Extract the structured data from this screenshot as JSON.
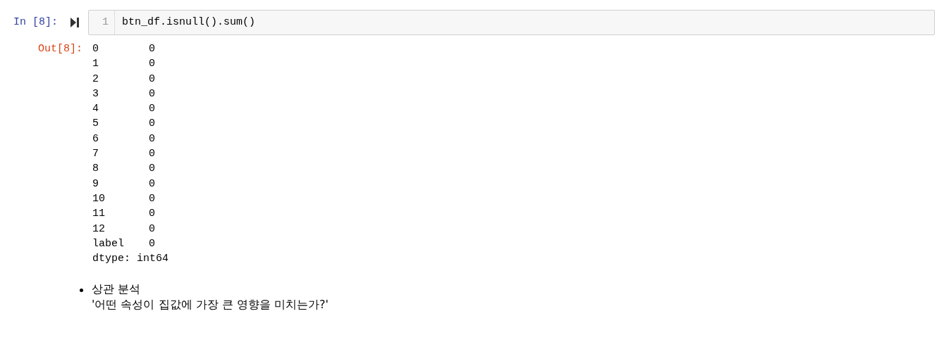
{
  "input_cell": {
    "prompt": "In [8]:",
    "line_number": "1",
    "code": "btn_df.isnull().sum()"
  },
  "output_cell": {
    "prompt": "Out[8]:",
    "rows": [
      {
        "index": "0",
        "value": "0"
      },
      {
        "index": "1",
        "value": "0"
      },
      {
        "index": "2",
        "value": "0"
      },
      {
        "index": "3",
        "value": "0"
      },
      {
        "index": "4",
        "value": "0"
      },
      {
        "index": "5",
        "value": "0"
      },
      {
        "index": "6",
        "value": "0"
      },
      {
        "index": "7",
        "value": "0"
      },
      {
        "index": "8",
        "value": "0"
      },
      {
        "index": "9",
        "value": "0"
      },
      {
        "index": "10",
        "value": "0"
      },
      {
        "index": "11",
        "value": "0"
      },
      {
        "index": "12",
        "value": "0"
      },
      {
        "index": "label",
        "value": "0"
      }
    ],
    "dtype": "dtype: int64"
  },
  "markdown_cell": {
    "bullets": [
      {
        "title": "상관 분석",
        "detail": "'어떤 속성이 집값에 가장 큰 영향을 미치는가?'"
      }
    ]
  }
}
